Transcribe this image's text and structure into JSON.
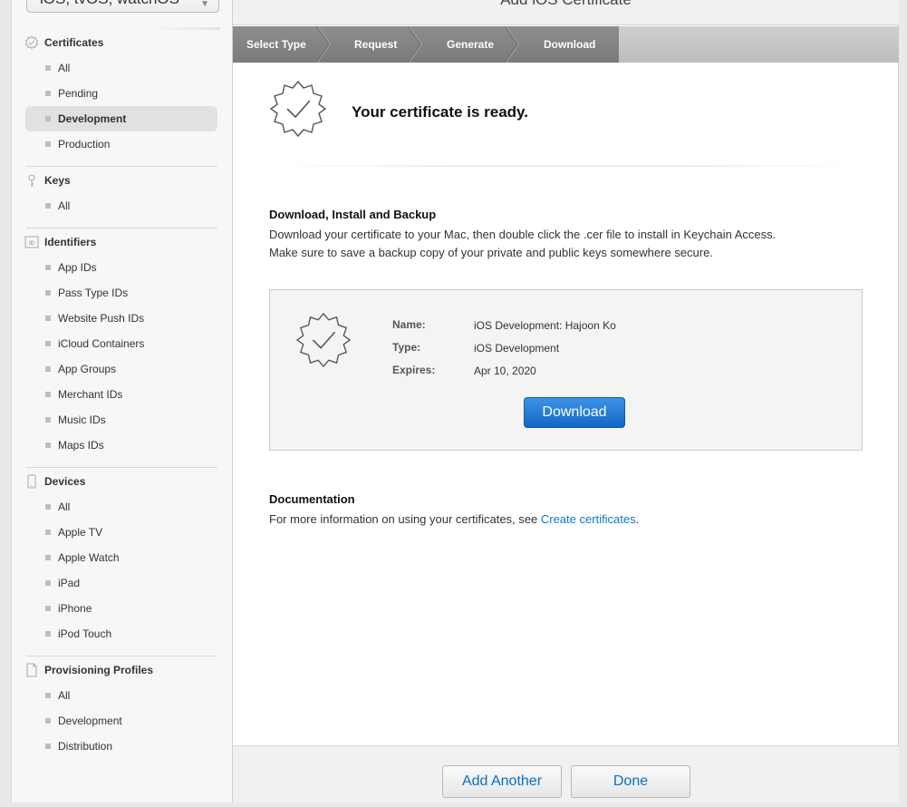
{
  "sidebar": {
    "platform_select": "iOS, tvOS, watchOS",
    "sections": [
      {
        "title": "Certificates",
        "icon": "certificate-icon",
        "items": [
          "All",
          "Pending",
          "Development",
          "Production"
        ],
        "active": "Development"
      },
      {
        "title": "Keys",
        "icon": "key-icon",
        "items": [
          "All"
        ]
      },
      {
        "title": "Identifiers",
        "icon": "id-icon",
        "items": [
          "App IDs",
          "Pass Type IDs",
          "Website Push IDs",
          "iCloud Containers",
          "App Groups",
          "Merchant IDs",
          "Music IDs",
          "Maps IDs"
        ]
      },
      {
        "title": "Devices",
        "icon": "device-icon",
        "items": [
          "All",
          "Apple TV",
          "Apple Watch",
          "iPad",
          "iPhone",
          "iPod Touch"
        ]
      },
      {
        "title": "Provisioning Profiles",
        "icon": "document-icon",
        "items": [
          "All",
          "Development",
          "Distribution"
        ]
      }
    ]
  },
  "main": {
    "header_title": "Add iOS Certificate",
    "steps": [
      "Select Type",
      "Request",
      "Generate",
      "Download"
    ],
    "hero_title": "Your certificate is ready.",
    "download_section": {
      "heading": "Download, Install and Backup",
      "line1": "Download your certificate to your Mac, then double click the .cer file to install in Keychain Access.",
      "line2": "Make sure to save a backup copy of your private and public keys somewhere secure."
    },
    "certificate": {
      "name_label": "Name:",
      "name_value": "iOS Development: Hajoon Ko",
      "type_label": "Type:",
      "type_value": "iOS Development",
      "expires_label": "Expires:",
      "expires_value": "Apr 10, 2020",
      "download_label": "Download"
    },
    "documentation": {
      "heading": "Documentation",
      "text_before": "For more information on using your certificates, see ",
      "link_text": "Create certificates",
      "text_after": "."
    },
    "footer": {
      "add_another_label": "Add Another",
      "done_label": "Done"
    }
  }
}
